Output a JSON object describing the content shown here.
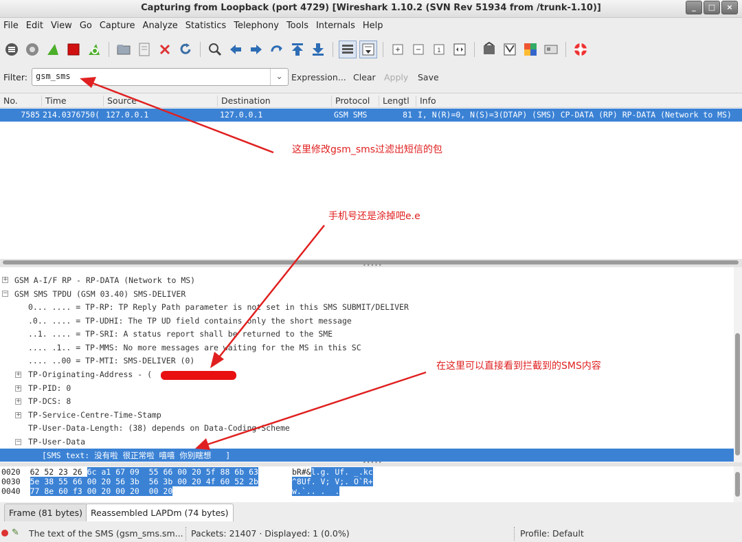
{
  "window": {
    "title": "Capturing from Loopback (port 4729)   [Wireshark 1.10.2  (SVN Rev 51934 from /trunk-1.10)]",
    "buttons": [
      "_",
      "□",
      "×"
    ]
  },
  "menu": [
    "File",
    "Edit",
    "View",
    "Go",
    "Capture",
    "Analyze",
    "Statistics",
    "Telephony",
    "Tools",
    "Internals",
    "Help"
  ],
  "toolbar": {
    "icons": [
      "interfaces-icon",
      "options-icon",
      "start-capture-icon",
      "stop-capture-icon",
      "restart-capture-icon",
      "open-icon",
      "save-icon",
      "close-file-icon",
      "reload-icon",
      "find-icon",
      "back-icon",
      "forward-icon",
      "goto-icon",
      "first-icon",
      "last-icon",
      "colorize-icon",
      "autoscroll-icon",
      "zoom-in-icon",
      "zoom-out-icon",
      "zoom-normal-icon",
      "resize-columns-icon",
      "capture-filters-icon",
      "display-filters-icon",
      "coloring-rules-icon",
      "preferences-icon",
      "help-icon"
    ]
  },
  "filter": {
    "label": "Filter:",
    "value": "gsm_sms",
    "expression": "Expression...",
    "clear": "Clear",
    "apply": "Apply",
    "save": "Save"
  },
  "packet_list": {
    "columns": [
      "No.",
      "Time",
      "Source",
      "Destination",
      "Protocol",
      "Lengtl",
      "Info"
    ],
    "rows": [
      {
        "no": "7585",
        "time": "214.0376750(",
        "source": "127.0.0.1",
        "destination": "127.0.0.1",
        "protocol": "GSM SMS",
        "length": "81",
        "info": "I, N(R)=0, N(S)=3(DTAP) (SMS) CP-DATA (RP) RP-DATA (Network to MS)"
      }
    ]
  },
  "details": {
    "lines": [
      "GSM A-I/F RP - RP-DATA (Network to MS)",
      "GSM SMS TPDU (GSM 03.40) SMS-DELIVER",
      "0... .... = TP-RP: TP Reply Path parameter is not set in this SMS SUBMIT/DELIVER",
      ".0.. .... = TP-UDHI: The TP UD field contains only the short message",
      "..1. .... = TP-SRI: A status report shall be returned to the SME",
      ".... .1.. = TP-MMS: No more messages are waiting for the MS in this SC",
      ".... ..00 = TP-MTI: SMS-DELIVER (0)",
      "TP-Originating-Address - (",
      "TP-PID: 0",
      "TP-DCS: 8",
      "TP-Service-Centre-Time-Stamp",
      "TP-User-Data-Length: (38) depends on Data-Coding-Scheme",
      "TP-User-Data",
      "[SMS text: 没有啦 很正常啦 嘻嘻 你别瞎想   ]"
    ]
  },
  "hex": {
    "rows": [
      {
        "offset": "0020",
        "plain_bytes": "62 52 23 26",
        "hl_bytes": "6c a1 67 09  55 66 00 20 5f 88 6b 63",
        "plain_ascii": "bR#&",
        "hl_ascii": "l.g. Uf. _.kc"
      },
      {
        "offset": "0030",
        "plain_bytes": "",
        "hl_bytes": "5e 38 55 66 00 20 56 3b  56 3b 00 20 4f 60 52 2b",
        "plain_ascii": "",
        "hl_ascii": "^8Uf. V; V;. O`R+"
      },
      {
        "offset": "0040",
        "plain_bytes": "",
        "hl_bytes": "77 8e 60 f3 00 20 00 20  00 20",
        "plain_ascii": "",
        "hl_ascii": "w.`.. .  ."
      }
    ]
  },
  "tabs": [
    "Frame (81 bytes)",
    "Reassembled LAPDm (74 bytes)"
  ],
  "status": {
    "text": "The text of the SMS (gsm_sms.sm...",
    "packets": "Packets: 21407 · Displayed: 1 (0.0%)",
    "profile": "Profile: Default"
  },
  "annotations": {
    "filter_note": "这里修改gsm_sms过滤出短信的包",
    "phone_note": "手机号还是涂掉吧e.e",
    "sms_note": "在这里可以直接看到拦截到的SMS内容"
  },
  "colors": {
    "selection": "#3b82d5",
    "annotation": "#e02020",
    "redaction": "#e81010"
  }
}
